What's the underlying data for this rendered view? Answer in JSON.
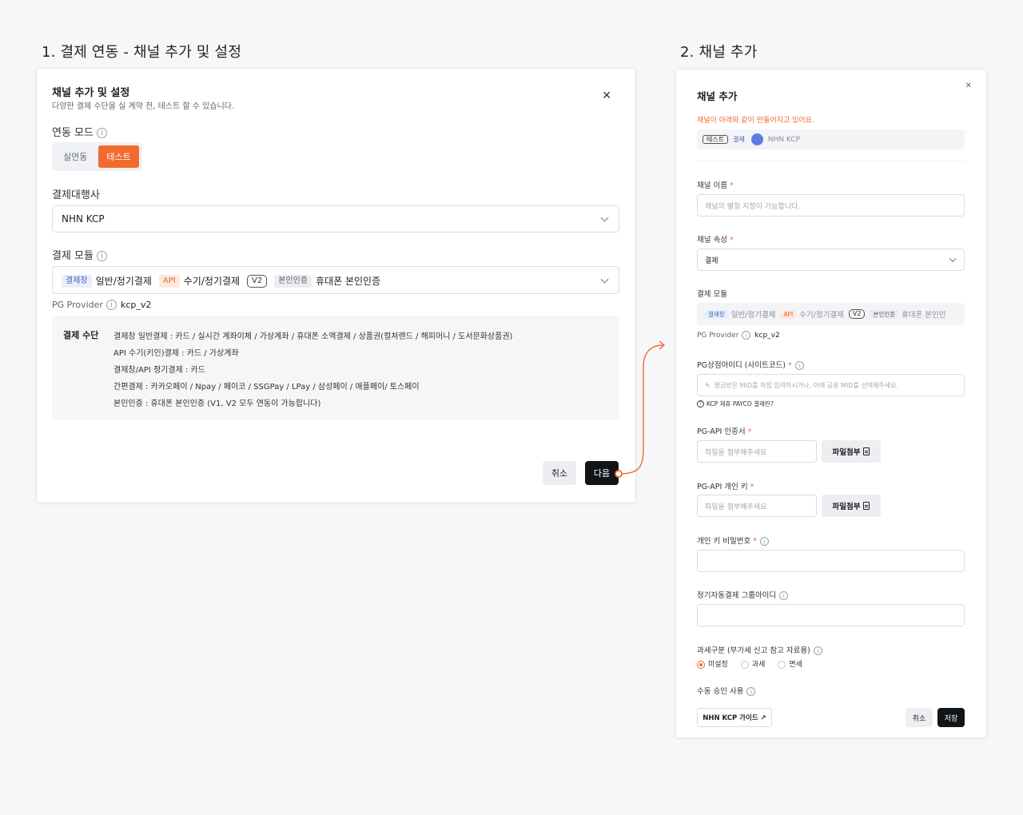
{
  "step1": {
    "title": "1. 결제 연동 - 채널 추가 및 설정"
  },
  "step2": {
    "title": "2. 채널 추가"
  },
  "left": {
    "heading": "채널 추가 및 설정",
    "subheading": "다양한 결제 수단을 실 계약 전, 테스트 할 수 있습니다.",
    "close": "✕",
    "mode_label": "연동 모드",
    "mode_options": [
      "실연동",
      "테스트"
    ],
    "mode_selected": "테스트",
    "pg_label": "결제대행사",
    "pg_value": "NHN KCP",
    "module_label": "결제 모듈",
    "modules": [
      {
        "tag": "결제창",
        "text": "일반/정기결제"
      },
      {
        "tag": "API",
        "text": "수기/정기결제"
      },
      {
        "tag": "V2"
      },
      {
        "tag": "본인인증",
        "text": "휴대폰 본인인증"
      }
    ],
    "provider_label": "PG Provider",
    "provider_value": "kcp_v2",
    "pay_title": "결제 수단",
    "pay_lines": [
      "결제창 일반결제 : 카드 / 실시간 계좌이체 / 가상계좌 / 휴대폰 소액결제 / 상품권(컬쳐랜드 / 해피머니 / 도서문화상품권)",
      "API 수기(키인)결제 : 카드 / 가상계좌",
      "결제창/API 정기결제 : 카드",
      "간편결제 : 카카오페이 / Npay / 페이코 / SSGPay / LPay / 삼성페이 / 애플페이/ 토스페이",
      "본인인증 : 휴대폰 본인인증 (V1, V2 모두 연동이 가능합니다)"
    ],
    "cancel": "취소",
    "next": "다음"
  },
  "right": {
    "heading": "채널 추가",
    "close": "✕",
    "notice": "채널이 아래와 같이 만들어지고 있어요.",
    "preview_tags": [
      "테스트",
      "결제"
    ],
    "preview_pg": "NHN KCP",
    "name_label": "채널 이름",
    "name_placeholder": "채널의 별칭 지정이 가능합니다.",
    "attr_label": "채널 속성",
    "attr_value": "결제",
    "module_label": "결제 모듈",
    "modules": [
      {
        "tag": "결제창",
        "text": "일반/정기결제"
      },
      {
        "tag": "API",
        "text": "수기/정기결제"
      },
      {
        "tag": "V2"
      },
      {
        "tag": "본인인증",
        "text": "휴대폰 본인인"
      }
    ],
    "provider_label": "PG Provider",
    "provider_value": "kcp_v2",
    "mid_label": "PG상점아이디 (사이트코드)",
    "mid_placeholder": "발급받은 MID를 직접 입력하시거나, 아래 공용 MID를 선택해주세요.",
    "mid_help": "KCP 제휴 PAYCO 결제란?",
    "cert_label": "PG-API 인증서",
    "cert_placeholder": "파일을 첨부해주세요",
    "cert_btn": "파일첨부",
    "key_label": "PG-API 개인 키",
    "key_placeholder": "파일을 첨부해주세요",
    "key_btn": "파일첨부",
    "keypw_label": "개인 키 비밀번호",
    "group_label": "정기자동결제 그룹아이디",
    "tax_label": "과세구분 (부가세 신고 참고 자료용)",
    "tax_options": [
      "미설정",
      "과세",
      "면세"
    ],
    "tax_selected": "미설정",
    "manual_label": "수동 승인 사용",
    "guide_btn": "NHN KCP 가이드 ↗",
    "cancel": "취소",
    "save": "저장"
  },
  "colors": {
    "accent": "#f26a2e",
    "dark": "#111418"
  }
}
